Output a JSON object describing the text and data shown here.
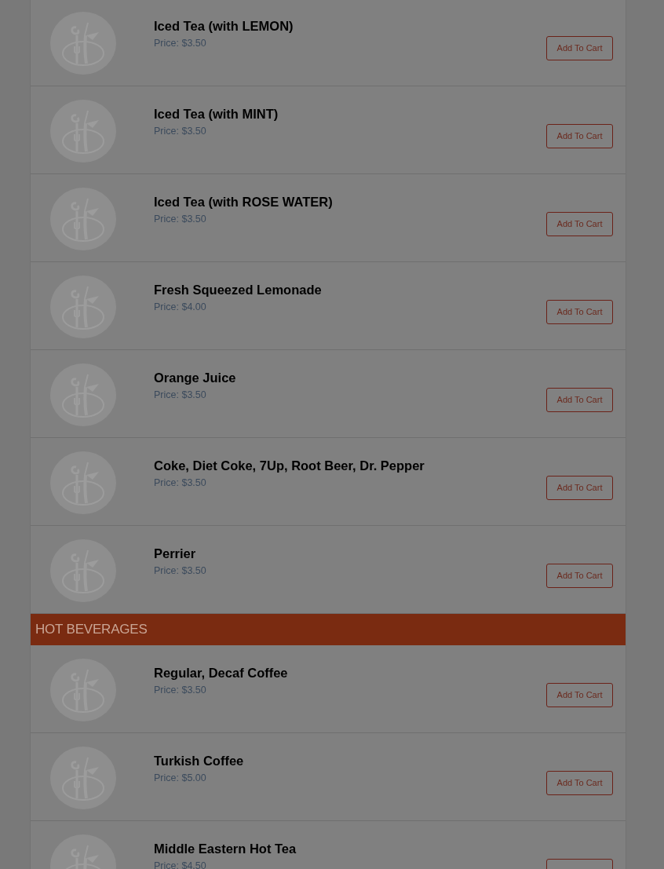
{
  "sections": [
    {
      "items": [
        {
          "name": "Iced Tea (with LEMON)",
          "price": "Price: $3.50",
          "button": "Add To Cart"
        },
        {
          "name": "Iced Tea (with MINT)",
          "price": "Price: $3.50",
          "button": "Add To Cart"
        },
        {
          "name": "Iced Tea (with ROSE WATER)",
          "price": "Price: $3.50",
          "button": "Add To Cart"
        },
        {
          "name": "Fresh Squeezed Lemonade",
          "price": "Price: $4.00",
          "button": "Add To Cart"
        },
        {
          "name": "Orange Juice",
          "price": "Price: $3.50",
          "button": "Add To Cart"
        },
        {
          "name": "Coke, Diet Coke, 7Up, Root Beer, Dr. Pepper",
          "price": "Price: $3.50",
          "button": "Add To Cart"
        },
        {
          "name": "Perrier",
          "price": "Price: $3.50",
          "button": "Add To Cart"
        }
      ]
    },
    {
      "heading": "HOT BEVERAGES",
      "items": [
        {
          "name": "Regular, Decaf Coffee",
          "price": "Price: $3.50",
          "button": "Add To Cart"
        },
        {
          "name": "Turkish Coffee",
          "price": "Price: $5.00",
          "button": "Add To Cart"
        },
        {
          "name": "Middle Eastern Hot Tea",
          "price": "Price: $4.50"
        }
      ]
    }
  ]
}
